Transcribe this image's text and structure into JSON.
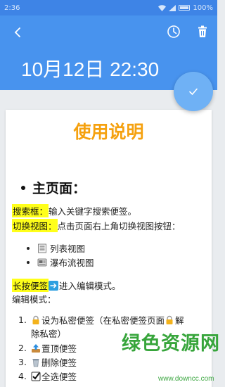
{
  "status_bar": {
    "time": "2:36",
    "battery": "100%"
  },
  "header": {
    "datetime": "10月12日 22:30"
  },
  "note": {
    "title": "使用说明",
    "section_heading": "主页面：",
    "search_label": "搜索框：",
    "search_text": "输入关键字搜索便签。",
    "switch_label": "切换视图：",
    "switch_text": "点击页面右上角切换视图按钮：",
    "view_list": "列表视图",
    "view_waterfall": "瀑布流视图",
    "longpress_label": "长按便签",
    "longpress_text": "进入编辑模式。",
    "edit_mode": "编辑模式：",
    "items": [
      {
        "num": "1.",
        "text": "设为私密便签（在私密便签页面",
        "text_tail": "解",
        "cont": "除私密）"
      },
      {
        "num": "2.",
        "text": "置顶便签"
      },
      {
        "num": "3.",
        "text": "删除便签"
      },
      {
        "num": "4.",
        "text": "全选便签"
      }
    ]
  },
  "watermark": {
    "name": "绿色资源网",
    "url": "www.downcc.com"
  },
  "colors": {
    "header": "#4893ee",
    "status": "#3e84e6",
    "title": "#f5a10f",
    "highlight": "#ffff1a",
    "fab": "#6fb1f5"
  },
  "icons": [
    "back-icon",
    "clock-icon",
    "trash-icon",
    "check-icon",
    "list-view-icon",
    "waterfall-view-icon",
    "arrow-right-icon",
    "lock-icon",
    "pin-top-icon",
    "trash-can-icon",
    "checkbox-icon"
  ]
}
